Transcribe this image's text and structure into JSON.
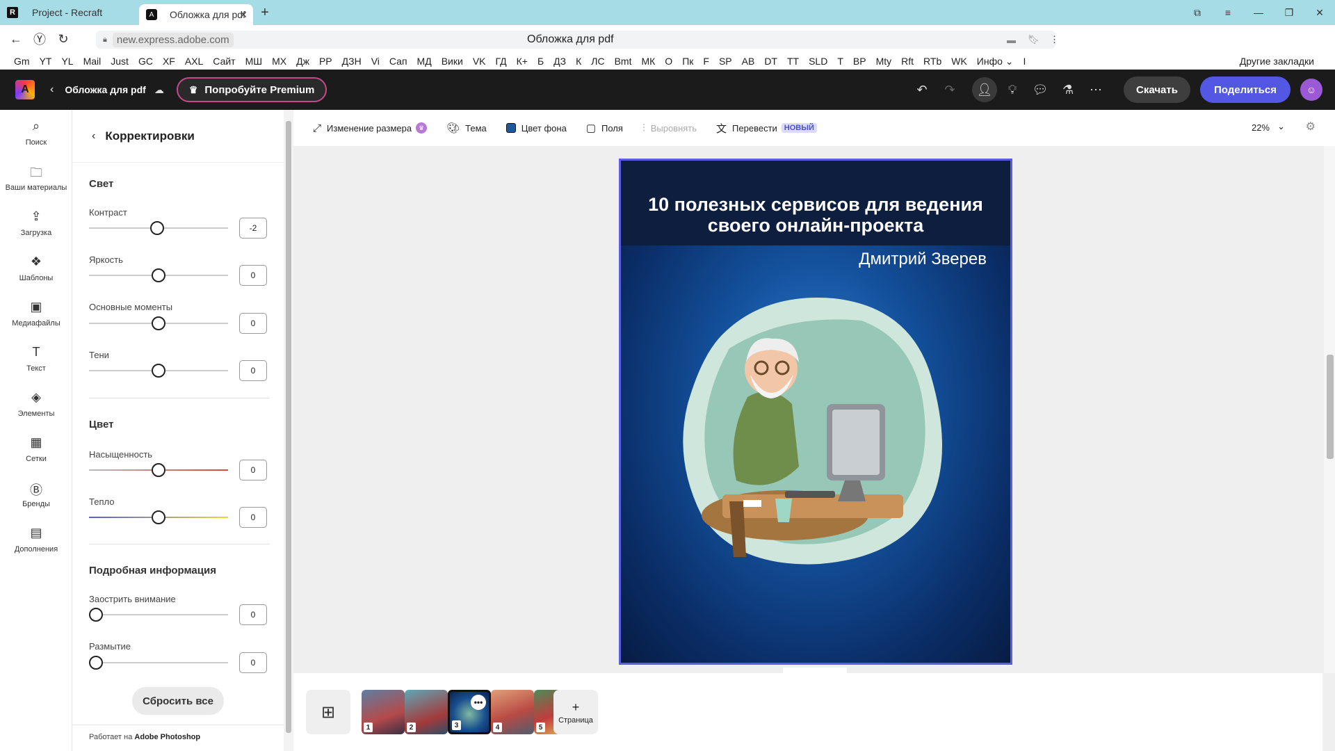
{
  "browser": {
    "tabs": [
      {
        "label": "Project - Recraft",
        "active": false
      },
      {
        "label": "Обложка для pdf",
        "active": true
      }
    ],
    "url_host": "new.express.adobe.com",
    "page_title": "Обложка для pdf",
    "bookmarks": [
      "Gm",
      "YT",
      "YL",
      "Mail",
      "Just",
      "GC",
      "XF",
      "AXL",
      "Сайт",
      "МШ",
      "МХ",
      "Дж",
      "РР",
      "ДЗН",
      "Vi",
      "Сап",
      "МД",
      "Вики",
      "VK",
      "ГД",
      "К+",
      "Б",
      "ДЗ",
      "К",
      "ЛС",
      "Bmt",
      "МК",
      "О",
      "Пк",
      "F",
      "SP",
      "АВ",
      "DT",
      "TT",
      "SLD",
      "T",
      "ВР",
      "Mty",
      "Rft",
      "RTb",
      "WK",
      "Инфо ⌄",
      "I"
    ],
    "other_bookmarks": "Другие закладки"
  },
  "header": {
    "doc_name": "Обложка для pdf",
    "premium_label": "Попробуйте Premium",
    "download_label": "Скачать",
    "share_label": "Поделиться"
  },
  "rail": [
    {
      "label": "Поиск",
      "icon": "search-icon",
      "glyph": "⌕"
    },
    {
      "label": "Ваши материалы",
      "icon": "folder-icon",
      "glyph": "🗀"
    },
    {
      "label": "Загрузка",
      "icon": "upload-icon",
      "glyph": "⇪"
    },
    {
      "label": "Шаблоны",
      "icon": "templates-icon",
      "glyph": "❖"
    },
    {
      "label": "Медиафайлы",
      "icon": "media-icon",
      "glyph": "▣"
    },
    {
      "label": "Текст",
      "icon": "text-icon",
      "glyph": "T"
    },
    {
      "label": "Элементы",
      "icon": "elements-icon",
      "glyph": "◈"
    },
    {
      "label": "Сетки",
      "icon": "grids-icon",
      "glyph": "▦"
    },
    {
      "label": "Бренды",
      "icon": "brands-icon",
      "glyph": "Ⓑ"
    },
    {
      "label": "Дополнения",
      "icon": "addons-icon",
      "glyph": "▤"
    }
  ],
  "panel": {
    "title": "Корректировки",
    "sections": {
      "light": "Свет",
      "color": "Цвет",
      "details": "Подробная информация"
    },
    "controls": {
      "contrast": {
        "label": "Контраст",
        "value": "-2"
      },
      "brightness": {
        "label": "Яркость",
        "value": "0"
      },
      "highlights": {
        "label": "Основные моменты",
        "value": "0"
      },
      "shadows": {
        "label": "Тени",
        "value": "0"
      },
      "saturation": {
        "label": "Насыщенность",
        "value": "0"
      },
      "warmth": {
        "label": "Тепло",
        "value": "0"
      },
      "sharpen": {
        "label": "Заострить внимание",
        "value": "0"
      },
      "blur": {
        "label": "Размытие",
        "value": "0"
      }
    },
    "reset_label": "Сбросить все",
    "powered_prefix": "Работает на",
    "powered_by": "Adobe Photoshop"
  },
  "toolbar": {
    "resize": "Изменение размера",
    "theme": "Тема",
    "bg_color": "Цвет фона",
    "margins": "Поля",
    "align": "Выровнять",
    "translate": "Перевести",
    "new_badge": "НОВЫЙ",
    "zoom": "22%"
  },
  "cover": {
    "title_line1": "10 полезных сервисов для ведения",
    "title_line2": "своего онлайн-проекта",
    "author": "Дмитрий Зверев"
  },
  "pages": {
    "numbers": [
      "1",
      "2",
      "3",
      "4",
      "5"
    ],
    "active": "3",
    "add_label": "Страница"
  },
  "colors": {
    "accent": "#5258e4",
    "header_bg": "#1b1b1b",
    "tabbar_bg": "#a6dce6"
  }
}
